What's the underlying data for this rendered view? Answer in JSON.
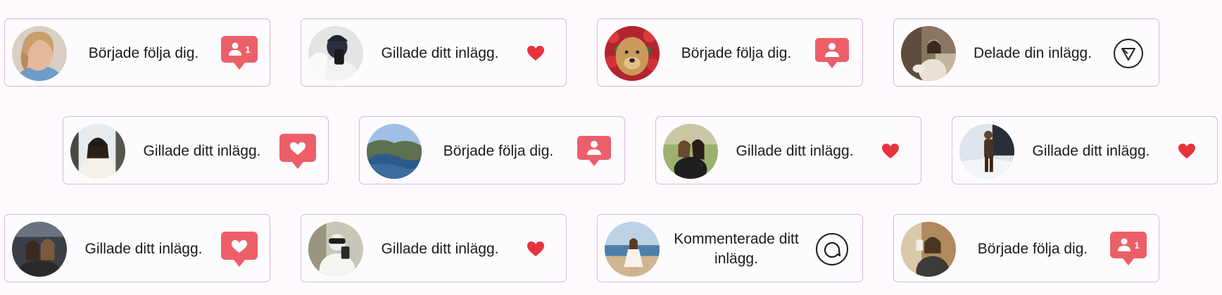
{
  "accent_color": "#ec5f69",
  "notifications": [
    {
      "text": "Började följa dig.",
      "icon": "follow-count-badge-icon",
      "badge_count": "1",
      "avatar": "blonde-woman-avatar"
    },
    {
      "text": "Gillade ditt inlägg.",
      "icon": "heart-icon",
      "avatar": "hooded-person-avatar"
    },
    {
      "text": "Började följa dig.",
      "icon": "follow-badge-icon",
      "avatar": "dog-with-roses-avatar"
    },
    {
      "text": "Delade din inlägg.",
      "icon": "send-icon",
      "avatar": "cafe-woman-avatar"
    },
    {
      "text": "Gillade ditt inlägg.",
      "icon": "like-badge-icon",
      "avatar": "winter-woman-avatar"
    },
    {
      "text": "Började följa dig.",
      "icon": "follow-badge-icon",
      "avatar": "coastline-avatar"
    },
    {
      "text": "Gillade ditt inlägg.",
      "icon": "heart-icon",
      "avatar": "two-friends-avatar"
    },
    {
      "text": "Gillade ditt inlägg.",
      "icon": "heart-icon",
      "avatar": "snow-person-avatar"
    },
    {
      "text": "Gillade ditt inlägg.",
      "icon": "like-badge-icon",
      "avatar": "car-friends-avatar"
    },
    {
      "text": "Gillade ditt inlägg.",
      "icon": "heart-icon",
      "avatar": "white-hoodie-avatar"
    },
    {
      "text": "Kommenterade ditt inlägg.",
      "icon": "comment-icon",
      "avatar": "beach-woman-avatar"
    },
    {
      "text": "Började följa dig.",
      "icon": "follow-count-badge-icon",
      "badge_count": "1",
      "avatar": "mirror-selfie-avatar"
    }
  ]
}
